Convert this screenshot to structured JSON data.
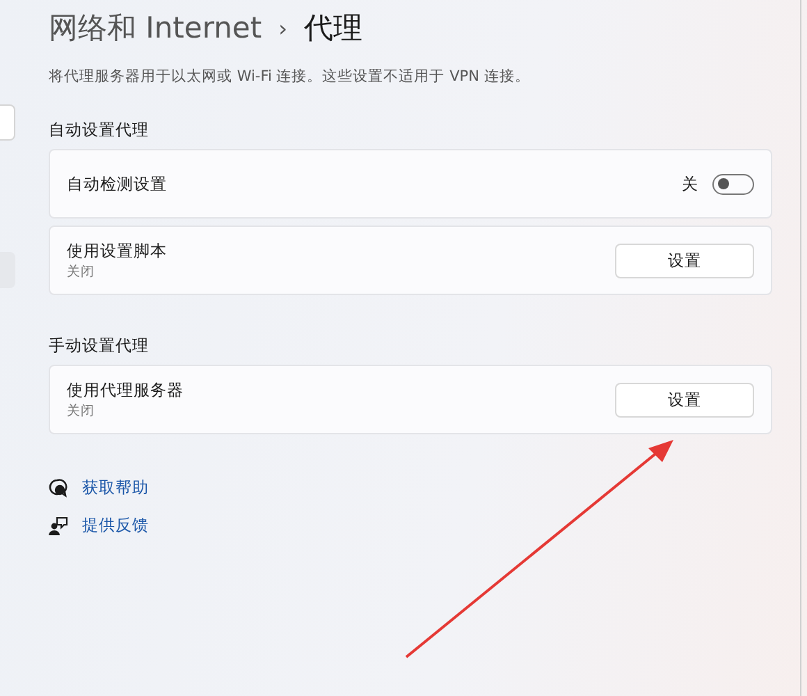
{
  "breadcrumb": {
    "parent": "网络和 Internet",
    "separator": "›",
    "current": "代理"
  },
  "description": "将代理服务器用于以太网或 Wi-Fi 连接。这些设置不适用于 VPN 连接。",
  "sections": [
    {
      "heading": "自动设置代理",
      "rows": [
        {
          "kind": "toggle",
          "title": "自动检测设置",
          "state_label": "关",
          "on": false
        },
        {
          "kind": "button",
          "title": "使用设置脚本",
          "subtitle": "关闭",
          "button": "设置"
        }
      ]
    },
    {
      "heading": "手动设置代理",
      "rows": [
        {
          "kind": "button",
          "title": "使用代理服务器",
          "subtitle": "关闭",
          "button": "设置"
        }
      ]
    }
  ],
  "links": [
    {
      "kind": "help",
      "label": "获取帮助"
    },
    {
      "kind": "feedback",
      "label": "提供反馈"
    }
  ]
}
